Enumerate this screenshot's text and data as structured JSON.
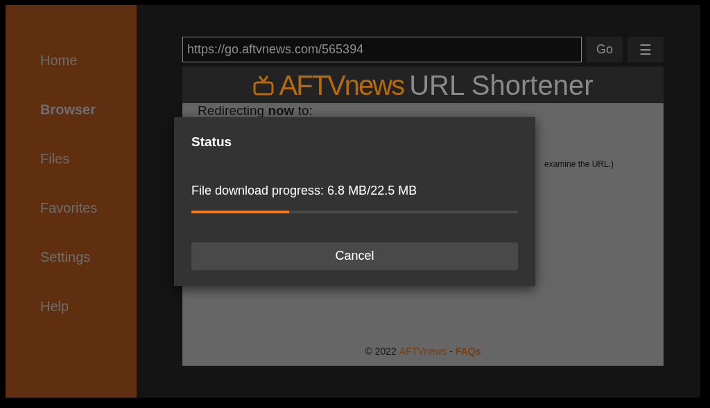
{
  "sidebar": {
    "items": [
      {
        "label": "Home",
        "selected": false
      },
      {
        "label": "Browser",
        "selected": true
      },
      {
        "label": "Files",
        "selected": false
      },
      {
        "label": "Favorites",
        "selected": false
      },
      {
        "label": "Settings",
        "selected": false
      },
      {
        "label": "Help",
        "selected": false
      }
    ]
  },
  "address_bar": {
    "value": "https://go.aftvnews.com/565394",
    "go_button": "Go",
    "menu_button": "☰"
  },
  "web_page": {
    "logo_text": "AFTVnews",
    "title": "URL Shortener",
    "redirect_text": "Redirecting **now** to:",
    "note_text": "examine the URL.)",
    "footer": {
      "copyright": "© 2022",
      "site_link": "AFTVnews",
      "separator": "-",
      "faq_link": "FAQs"
    }
  },
  "dialog": {
    "title": "Status",
    "message": "File download progress: 6.8 MB/22.5 MB",
    "progress": {
      "level": 0.3
    },
    "cancel_button": "Cancel"
  }
}
